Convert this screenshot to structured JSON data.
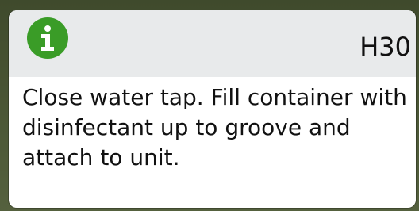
{
  "dialog": {
    "icon": "info-icon",
    "code": "H30",
    "message": "Close water tap. Fill container with disinfectant up to groove and attach to unit."
  },
  "colors": {
    "icon_bg": "#3a9c27",
    "header_bg": "#e8eaeb",
    "frame_bg": "#4f5a3a"
  }
}
